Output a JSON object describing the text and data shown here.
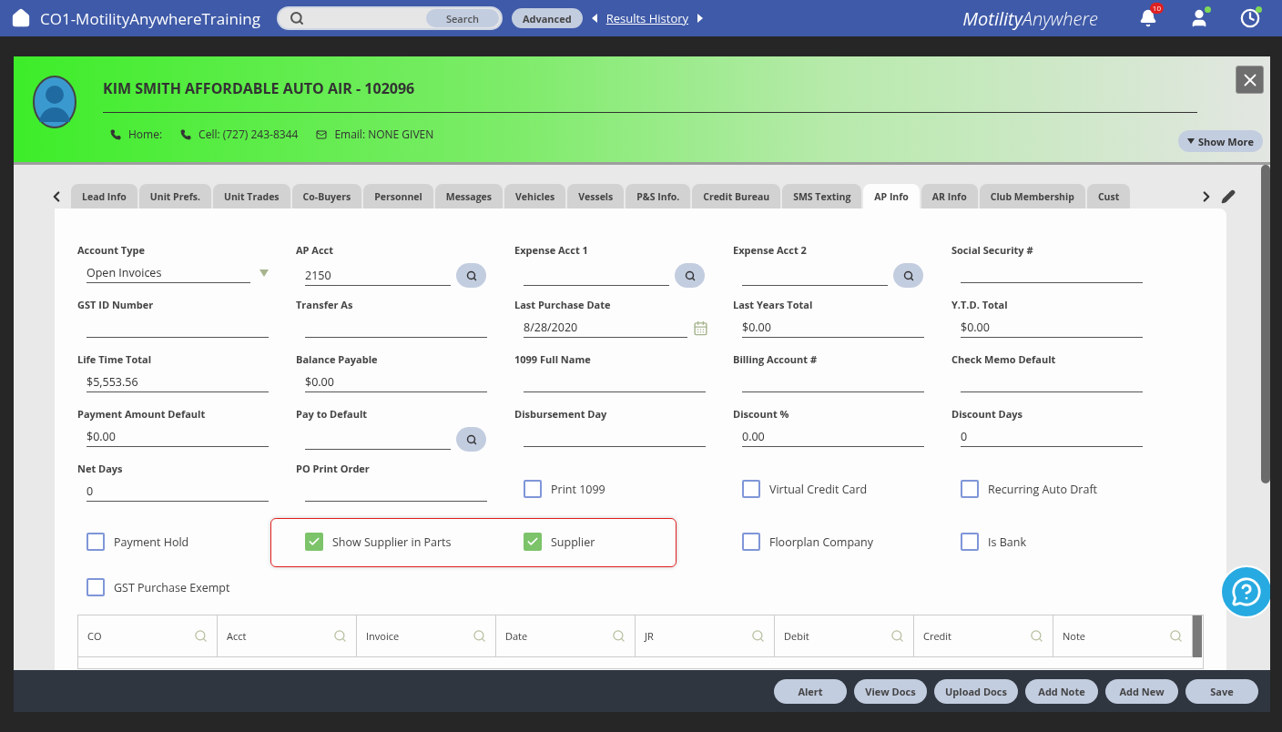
{
  "app_bar": {
    "title": "CO1-MotilityAnywhereTraining",
    "search_button": "Search",
    "advanced": "Advanced",
    "results_history": "Results History",
    "brand": "**Motility**Anywhere",
    "notification_count": "10"
  },
  "customer": {
    "name": "KIM SMITH AFFORDABLE AUTO AIR - 102096",
    "contacts": [
      {
        "kind": "phone",
        "text": "Home:"
      },
      {
        "kind": "phone",
        "text": "Cell: (727) 243-8344"
      },
      {
        "kind": "email",
        "text": "Email: NONE GIVEN"
      }
    ],
    "show_more": "Show More"
  },
  "tabs": [
    {
      "label": "Lead Info",
      "selected": false
    },
    {
      "label": "Unit Prefs.",
      "selected": false
    },
    {
      "label": "Unit Trades",
      "selected": false
    },
    {
      "label": "Co-Buyers",
      "selected": false
    },
    {
      "label": "Personnel",
      "selected": false
    },
    {
      "label": "Messages",
      "selected": false
    },
    {
      "label": "Vehicles",
      "selected": false
    },
    {
      "label": "Vessels",
      "selected": false
    },
    {
      "label": "P&S Info.",
      "selected": false
    },
    {
      "label": "Credit Bureau",
      "selected": false
    },
    {
      "label": "SMS Texting",
      "selected": false
    },
    {
      "label": "AP Info",
      "selected": true
    },
    {
      "label": "AR Info",
      "selected": false
    },
    {
      "label": "Club Membership",
      "selected": false
    },
    {
      "label": "Cust",
      "selected": false
    }
  ],
  "form": {
    "rows": [
      {
        "fields": [
          {
            "kind": "select",
            "label": "Account Type",
            "value": "Open Invoices"
          },
          {
            "kind": "lookup",
            "label": "AP Acct",
            "value": "2150"
          },
          {
            "kind": "lookup",
            "label": "Expense Acct 1"
          },
          {
            "kind": "lookup",
            "label": "Expense Acct 2"
          },
          {
            "kind": "text",
            "label": "Social Security #"
          }
        ]
      },
      {
        "fields": [
          {
            "kind": "text",
            "label": "GST ID Number"
          },
          {
            "kind": "text",
            "label": "Transfer As"
          },
          {
            "kind": "date",
            "label": "Last Purchase Date",
            "value": "8/28/2020"
          },
          {
            "kind": "text",
            "label": "Last Years Total",
            "value": "$0.00"
          },
          {
            "kind": "text",
            "label": "Y.T.D. Total",
            "value": "$0.00"
          }
        ]
      },
      {
        "fields": [
          {
            "kind": "text",
            "label": "Life Time Total",
            "value": "$5,553.56"
          },
          {
            "kind": "text",
            "label": "Balance Payable",
            "value": "$0.00"
          },
          {
            "kind": "text",
            "label": "1099 Full Name"
          },
          {
            "kind": "text",
            "label": "Billing Account #"
          },
          {
            "kind": "text",
            "label": "Check Memo Default"
          }
        ]
      },
      {
        "fields": [
          {
            "kind": "text",
            "label": "Payment Amount Default",
            "value": "$0.00"
          },
          {
            "kind": "lookup",
            "label": "Pay to Default"
          },
          {
            "kind": "text",
            "label": "Disbursement Day"
          },
          {
            "kind": "text",
            "label": "Discount %",
            "value": "0.00"
          },
          {
            "kind": "text",
            "label": "Discount Days",
            "value": "0"
          }
        ]
      },
      {
        "fields": [
          {
            "kind": "text",
            "label": "Net Days",
            "value": "0"
          },
          {
            "kind": "text",
            "label": "PO Print Order"
          },
          {
            "kind": "checkbox",
            "label": "Print 1099",
            "checked": false,
            "highlighted": false
          },
          {
            "kind": "checkbox",
            "label": "Virtual Credit Card",
            "checked": false,
            "highlighted": false
          },
          {
            "kind": "checkbox",
            "label": "Recurring Auto Draft",
            "checked": false,
            "highlighted": false
          }
        ]
      },
      {
        "fields": [
          {
            "kind": "checkbox",
            "label": "Payment Hold",
            "checked": false,
            "highlighted": false
          },
          {
            "kind": "checkbox",
            "label": "Show Supplier in Parts",
            "checked": true,
            "highlighted": true
          },
          {
            "kind": "checkbox",
            "label": "Supplier",
            "checked": true,
            "highlighted": true
          },
          {
            "kind": "checkbox",
            "label": "Floorplan Company",
            "checked": false,
            "highlighted": false
          },
          {
            "kind": "checkbox",
            "label": "Is Bank",
            "checked": false,
            "highlighted": false
          }
        ]
      },
      {
        "fields": [
          {
            "kind": "checkbox",
            "label": "GST Purchase Exempt",
            "checked": false,
            "highlighted": false
          }
        ]
      }
    ]
  },
  "table": {
    "columns": [
      "CO",
      "Acct",
      "Invoice",
      "Date",
      "JR",
      "Debit",
      "Credit",
      "Note"
    ]
  },
  "actions": [
    "Alert",
    "View Docs",
    "Upload Docs",
    "Add Note",
    "Add New",
    "Save"
  ]
}
